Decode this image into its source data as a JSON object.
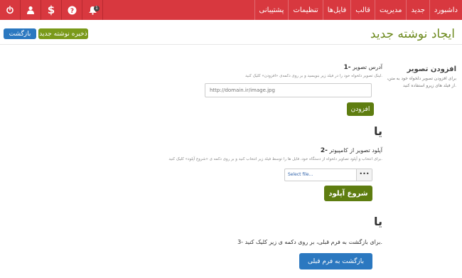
{
  "topbar": {
    "menu": [
      "داشبورد",
      "جدید",
      "مدیریت",
      "قالب",
      "فایل‌ها",
      "تنظیمات",
      "پشتیبانی"
    ],
    "icons": [
      "power-icon",
      "user-icon",
      "dollar-icon",
      "help-icon",
      "bell-icon"
    ],
    "notification_count": "1",
    "bg_color": "#d8383f"
  },
  "header": {
    "title": "ایجاد نوشته جدید",
    "back_label": "بازگشت",
    "save_label": "ذخیره نوشته جدید"
  },
  "help": {
    "title": "افزودن تصویر",
    "text": "برای افزودن تصویر دلخواه خود به متن، از فیلد های زیرو استفاده کنید."
  },
  "section1": {
    "title_num": "1-",
    "title": "آدرس تصویر",
    "desc": "لینک تصویر دلخواه خود را در فیلد زیر بنویسید و بر روی دکمه‌ی «افزودن» کلیک کنید.",
    "placeholder": "http://domain.ir/image.jpg",
    "add_label": "افزودن"
  },
  "or1": "یا",
  "section2": {
    "title_num": "2-",
    "title": "آپلود تصویر از کامپیوتر",
    "desc": "برای انتخاب و آپلود تصاویر دلخواه از دستگاه خود، فایل ها را توسط فیلد زیر انتخاب کنید و بر روی دکمه ی «شروع آپلود» کلیک کنید.",
    "file_placeholder": "Select file...",
    "browse_label": "•••",
    "upload_label": "شروع آپلود"
  },
  "or2": "یا",
  "section3": {
    "text": "3- برای بازگشت به فرم قبلی، بر روی دکمه ی زیر کلیک کنید.",
    "button_label": "بازگشت به فرم قبلی"
  }
}
